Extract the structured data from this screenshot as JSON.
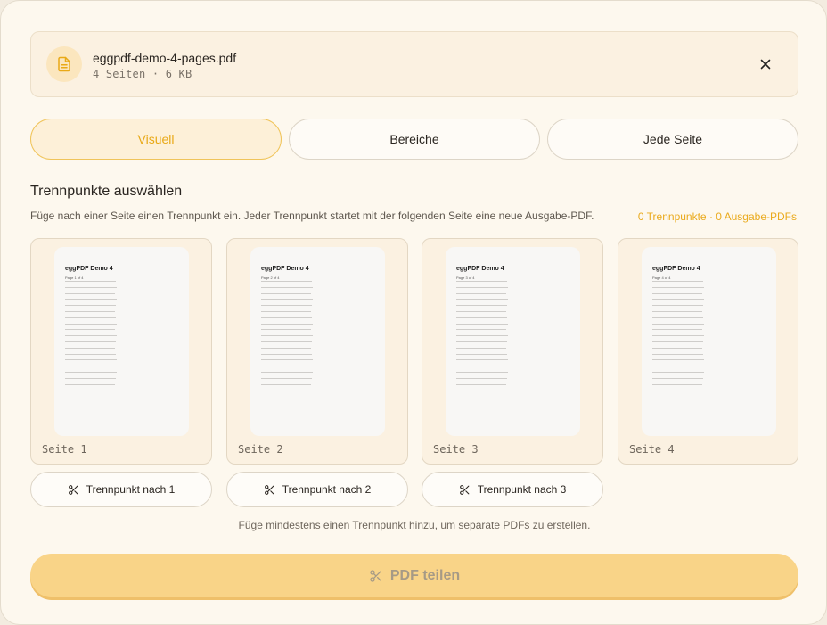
{
  "file": {
    "name": "eggpdf-demo-4-pages.pdf",
    "pages": "4 Seiten",
    "size": "6 KB"
  },
  "tabs": [
    {
      "label": "Visuell",
      "active": true
    },
    {
      "label": "Bereiche",
      "active": false
    },
    {
      "label": "Jede Seite",
      "active": false
    }
  ],
  "section": {
    "title": "Trennpunkte auswählen",
    "description": "Füge nach einer Seite einen Trennpunkt ein. Jeder Trennpunkt startet mit der folgenden Seite eine neue Ausgabe-PDF.",
    "breakpoints": "0 Trennpunkte",
    "outputs": "0 Ausgabe-PDFs"
  },
  "pages": [
    {
      "label": "Seite 1",
      "thumb_title": "eggPDF Demo 4",
      "thumb_sub": "Page 1 of 4"
    },
    {
      "label": "Seite 2",
      "thumb_title": "eggPDF Demo 4",
      "thumb_sub": "Page 2 of 4"
    },
    {
      "label": "Seite 3",
      "thumb_title": "eggPDF Demo 4",
      "thumb_sub": "Page 3 of 4"
    },
    {
      "label": "Seite 4",
      "thumb_title": "eggPDF Demo 4",
      "thumb_sub": "Page 4 of 4"
    }
  ],
  "split_buttons": [
    {
      "label": "Trennpunkt nach 1"
    },
    {
      "label": "Trennpunkt nach 2"
    },
    {
      "label": "Trennpunkt nach 3"
    }
  ],
  "hint": "Füge mindestens einen Trennpunkt hinzu, um separate PDFs zu erstellen.",
  "submit_label": "PDF teilen",
  "colors": {
    "accent": "#eaaa1c",
    "background": "#fdf8ee",
    "submit_disabled": "#f9d488"
  },
  "icons": {
    "file": "document-icon",
    "close": "close-icon",
    "scissors": "scissors-icon"
  }
}
